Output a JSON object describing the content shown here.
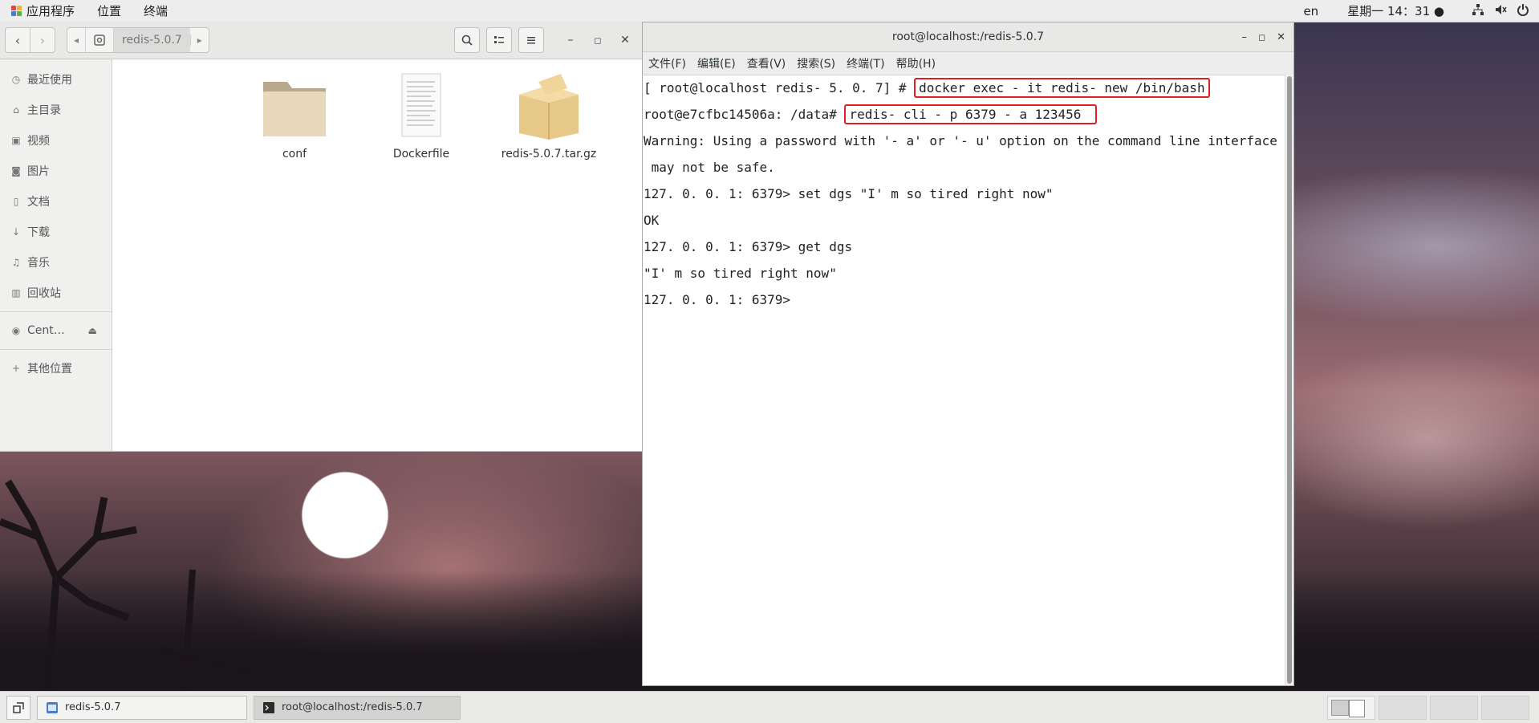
{
  "topbar": {
    "apps": "应用程序",
    "places": "位置",
    "terminal": "终端",
    "lang": "en",
    "clock": "星期一 14：31 ●"
  },
  "file_manager": {
    "path_segment": "redis-5.0.7",
    "sidebar": [
      {
        "label": "最近使用",
        "icon": "clock-icon"
      },
      {
        "label": "主目录",
        "icon": "home-icon"
      },
      {
        "label": "视频",
        "icon": "video-icon"
      },
      {
        "label": "图片",
        "icon": "camera-icon"
      },
      {
        "label": "文档",
        "icon": "document-icon"
      },
      {
        "label": "下载",
        "icon": "download-icon"
      },
      {
        "label": "音乐",
        "icon": "music-icon"
      },
      {
        "label": "回收站",
        "icon": "trash-icon"
      }
    ],
    "device": "Cent…",
    "other_locations": "其他位置",
    "files": [
      {
        "name": "conf",
        "type": "folder"
      },
      {
        "name": "Dockerfile",
        "type": "document"
      },
      {
        "name": "redis-5.0.7.tar.gz",
        "type": "archive"
      }
    ]
  },
  "terminal": {
    "title": "root@localhost:/redis-5.0.7",
    "menu": [
      "文件(F)",
      "编辑(E)",
      "查看(V)",
      "搜索(S)",
      "终端(T)",
      "帮助(H)"
    ],
    "lines": {
      "l1_prompt": "[ root@localhost redis- 5. 0. 7] # ",
      "l1_cmd": "docker exec - it redis- new /bin/bash",
      "l2_prompt": "root@e7cfbc14506a: /data# ",
      "l2_cmd": "redis- cli - p 6379 - a 123456",
      "l3": "Warning: Using a password with '- a' or '- u' option on the command line interface",
      "l4": " may not be safe.",
      "l5": "127. 0. 0. 1: 6379> set dgs \"I' m so tired right now\"",
      "l6": "OK",
      "l7": "127. 0. 0. 1: 6379> get dgs",
      "l8": "\"I' m so tired right now\"",
      "l9": "127. 0. 0. 1: 6379> "
    }
  },
  "taskbar": {
    "item1": "redis-5.0.7",
    "item2": "root@localhost:/redis-5.0.7"
  },
  "colors": {
    "highlight_box": "#e02020",
    "terminal_bg": "#ffffff"
  }
}
